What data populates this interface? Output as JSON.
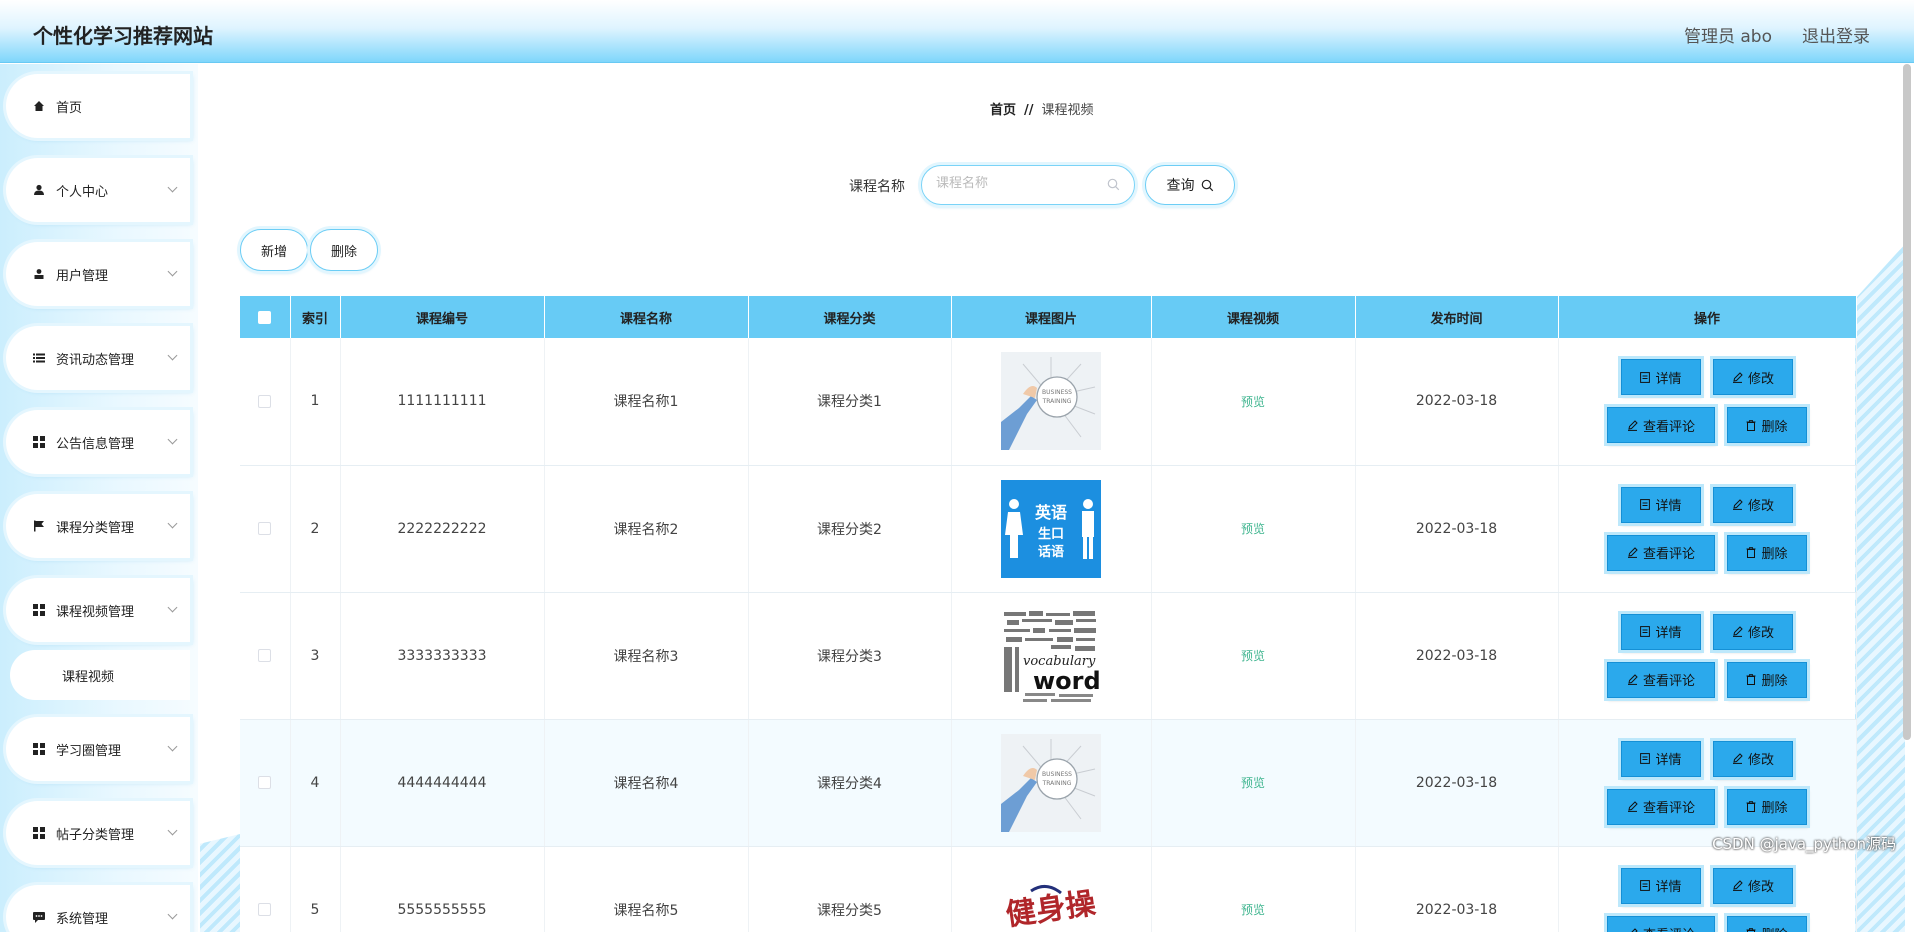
{
  "header": {
    "site_title": "个性化学习推荐网站",
    "user_label": "管理员 abo",
    "logout_label": "退出登录"
  },
  "sidebar": {
    "items": [
      {
        "label": "首页",
        "icon": "home-icon"
      },
      {
        "label": "个人中心",
        "icon": "user-icon"
      },
      {
        "label": "用户管理",
        "icon": "user-manage-icon"
      },
      {
        "label": "资讯动态管理",
        "icon": "list-icon"
      },
      {
        "label": "公告信息管理",
        "icon": "grid-icon"
      },
      {
        "label": "课程分类管理",
        "icon": "flag-icon"
      },
      {
        "label": "课程视频管理",
        "icon": "grid-icon"
      },
      {
        "label": "学习圈管理",
        "icon": "grid-icon"
      },
      {
        "label": "帖子分类管理",
        "icon": "grid-icon"
      },
      {
        "label": "系统管理",
        "icon": "chat-icon"
      }
    ],
    "sub_item": "课程视频"
  },
  "breadcrumb": {
    "home": "首页",
    "separator": "//",
    "current": "课程视频"
  },
  "search": {
    "label": "课程名称",
    "placeholder": "课程名称",
    "value": "",
    "button_label": "查询"
  },
  "actions": {
    "add_label": "新增",
    "delete_label": "删除"
  },
  "table": {
    "columns": [
      "索引",
      "课程编号",
      "课程名称",
      "课程分类",
      "课程图片",
      "课程视频",
      "发布时间",
      "操作"
    ],
    "preview_label": "预览",
    "op_labels": {
      "detail": "详情",
      "edit": "修改",
      "comments": "查看评论",
      "delete": "删除"
    },
    "rows": [
      {
        "index": "1",
        "code": "1111111111",
        "name": "课程名称1",
        "category": "课程分类1",
        "image": "business-training",
        "date": "2022-03-18"
      },
      {
        "index": "2",
        "code": "2222222222",
        "name": "课程名称2",
        "category": "课程分类2",
        "image": "english-speaking",
        "date": "2022-03-18",
        "image_text": [
          "英语",
          "生口",
          "话语"
        ]
      },
      {
        "index": "3",
        "code": "3333333333",
        "name": "课程名称3",
        "category": "课程分类3",
        "image": "vocabulary-words",
        "date": "2022-03-18",
        "image_text": [
          "vocabulary",
          "words"
        ]
      },
      {
        "index": "4",
        "code": "4444444444",
        "name": "课程名称4",
        "category": "课程分类4",
        "image": "business-training",
        "date": "2022-03-18"
      },
      {
        "index": "5",
        "code": "5555555555",
        "name": "课程名称5",
        "category": "课程分类5",
        "image": "fitness-calligraphy",
        "date": "2022-03-18",
        "image_text": [
          "健身操"
        ]
      }
    ]
  },
  "watermark": "CSDN @java_python源码",
  "colors": {
    "accent": "#67cbf5",
    "button": "#2ba9ec",
    "preview": "#3fb58f"
  }
}
